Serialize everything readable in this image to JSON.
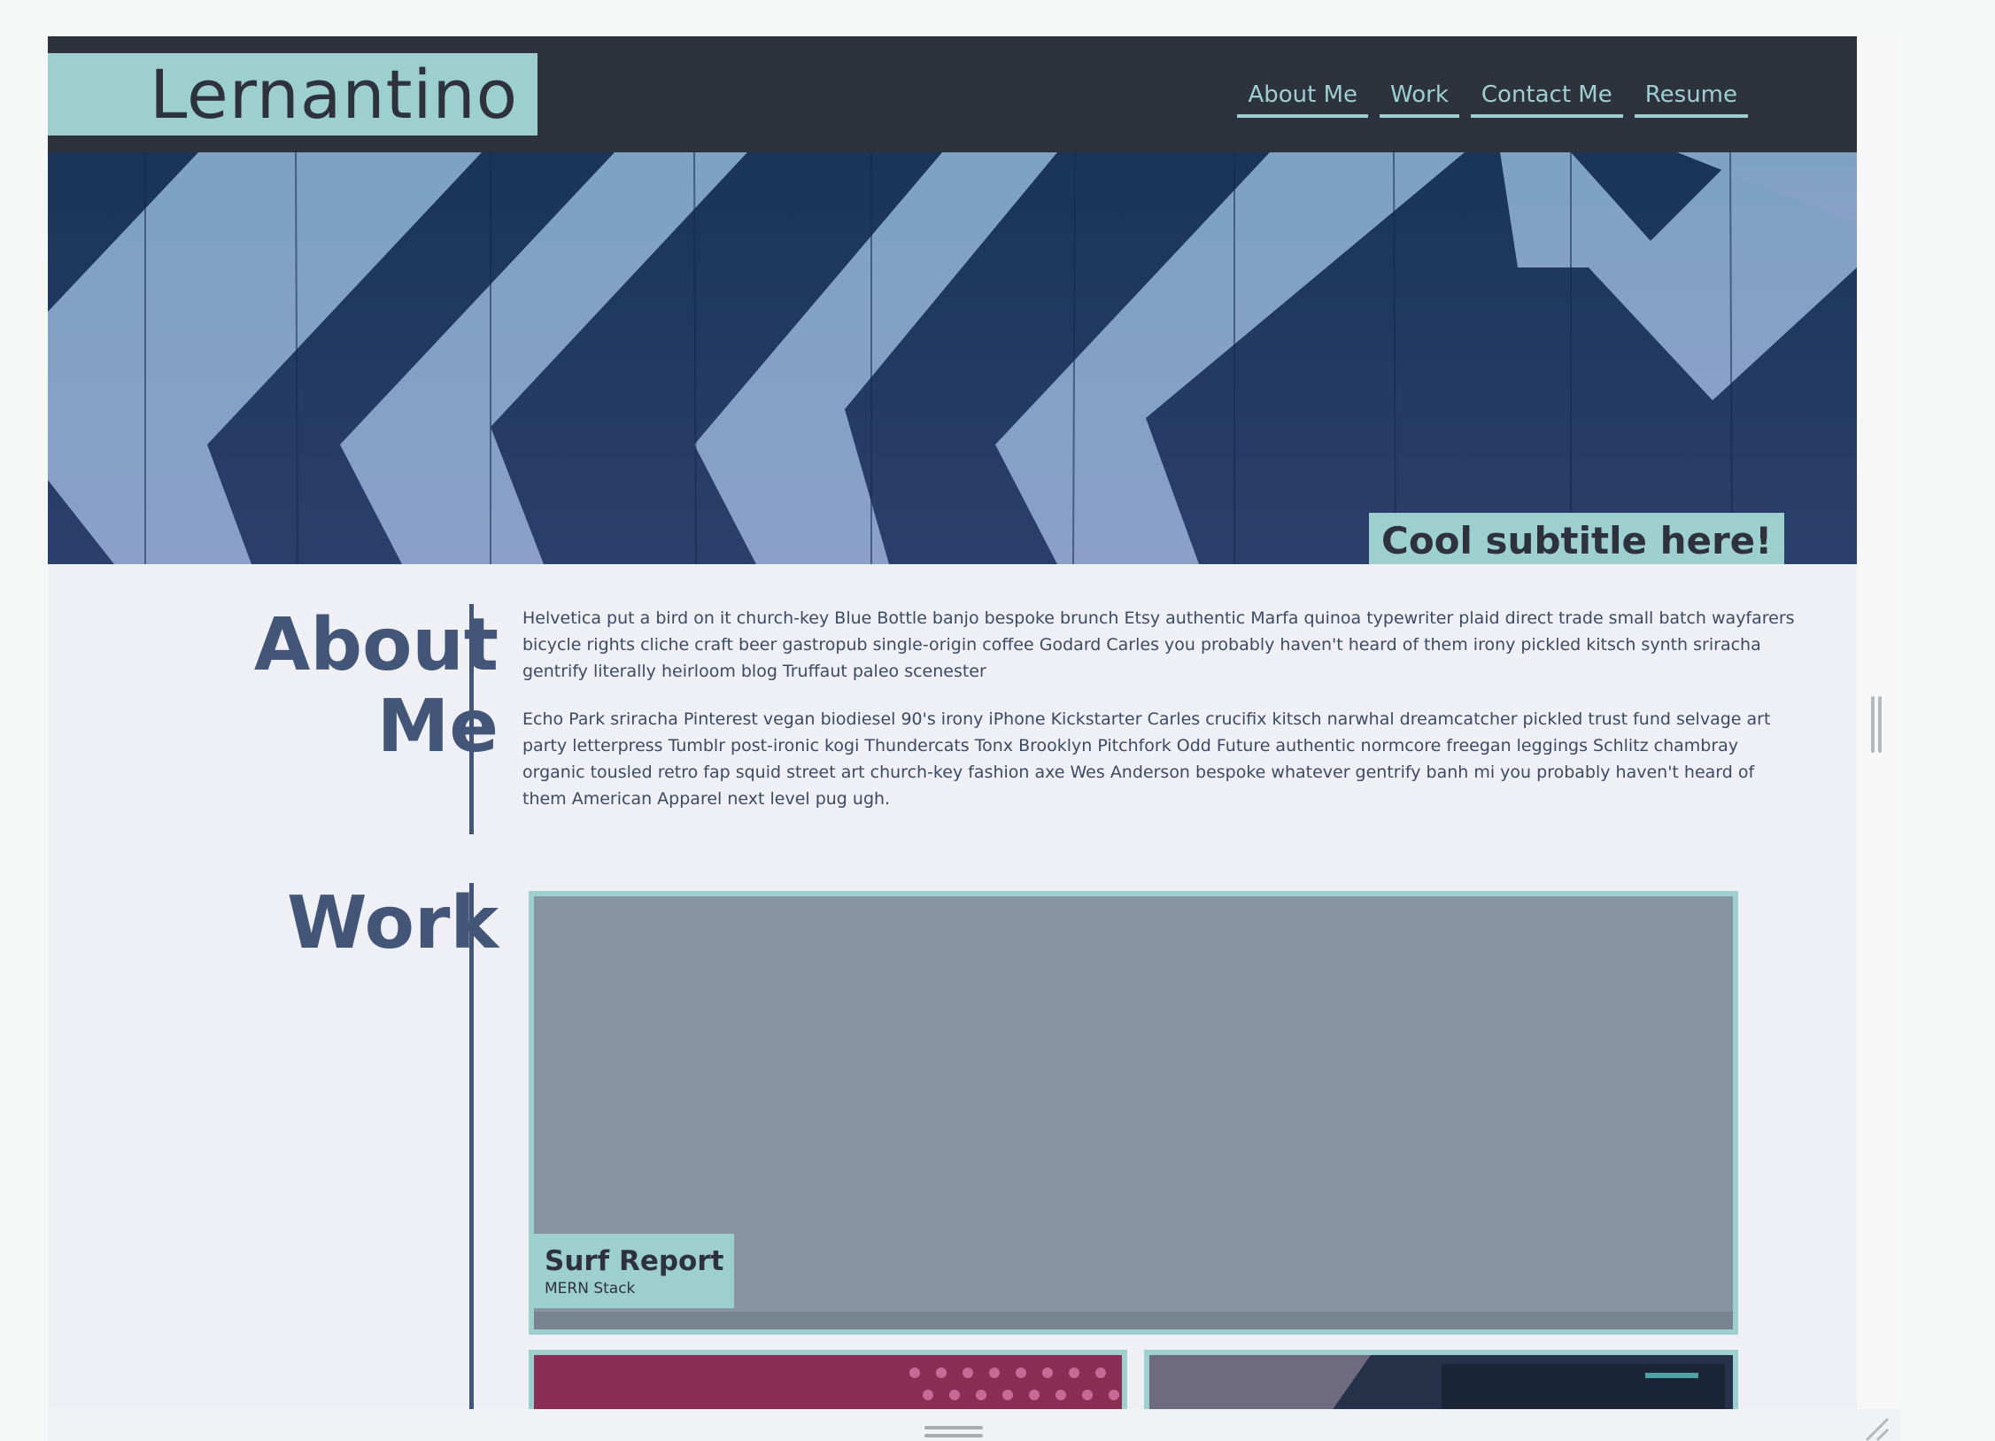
{
  "site": {
    "logo": "Lernantino",
    "nav": [
      {
        "label": "About Me"
      },
      {
        "label": "Work"
      },
      {
        "label": "Contact Me"
      },
      {
        "label": "Resume"
      }
    ]
  },
  "hero": {
    "subtitle": "Cool subtitle here!"
  },
  "about": {
    "title_line1": "About",
    "title_line2": "Me",
    "paragraphs": [
      "Helvetica put a bird on it church-key Blue Bottle banjo bespoke brunch Etsy authentic Marfa quinoa typewriter plaid direct trade small batch wayfarers bicycle rights cliche craft beer gastropub single-origin coffee Godard Carles you probably haven't heard of them irony pickled kitsch synth sriracha gentrify literally heirloom blog Truffaut paleo scenester",
      "Echo Park sriracha Pinterest vegan biodiesel 90's irony iPhone Kickstarter Carles crucifix kitsch narwhal dreamcatcher pickled trust fund selvage art party letterpress Tumblr post-ironic kogi Thundercats Tonx Brooklyn Pitchfork Odd Future authentic normcore freegan leggings Schlitz chambray organic tousled retro fap squid street art church-key fashion axe Wes Anderson bespoke whatever gentrify banh mi you probably haven't heard of them American Apparel next level pug ugh."
    ]
  },
  "work": {
    "title": "Work",
    "projects": [
      {
        "title": "Surf Report",
        "subtitle": "MERN Stack"
      }
    ]
  },
  "colors": {
    "header_bg": "#2e323d",
    "accent": "#9dcfcf",
    "heading": "#445678",
    "page_bg": "#efeff6"
  },
  "icons": [
    "scrollbar-grip-icon",
    "drag-handle-icon",
    "resize-corner-icon"
  ]
}
